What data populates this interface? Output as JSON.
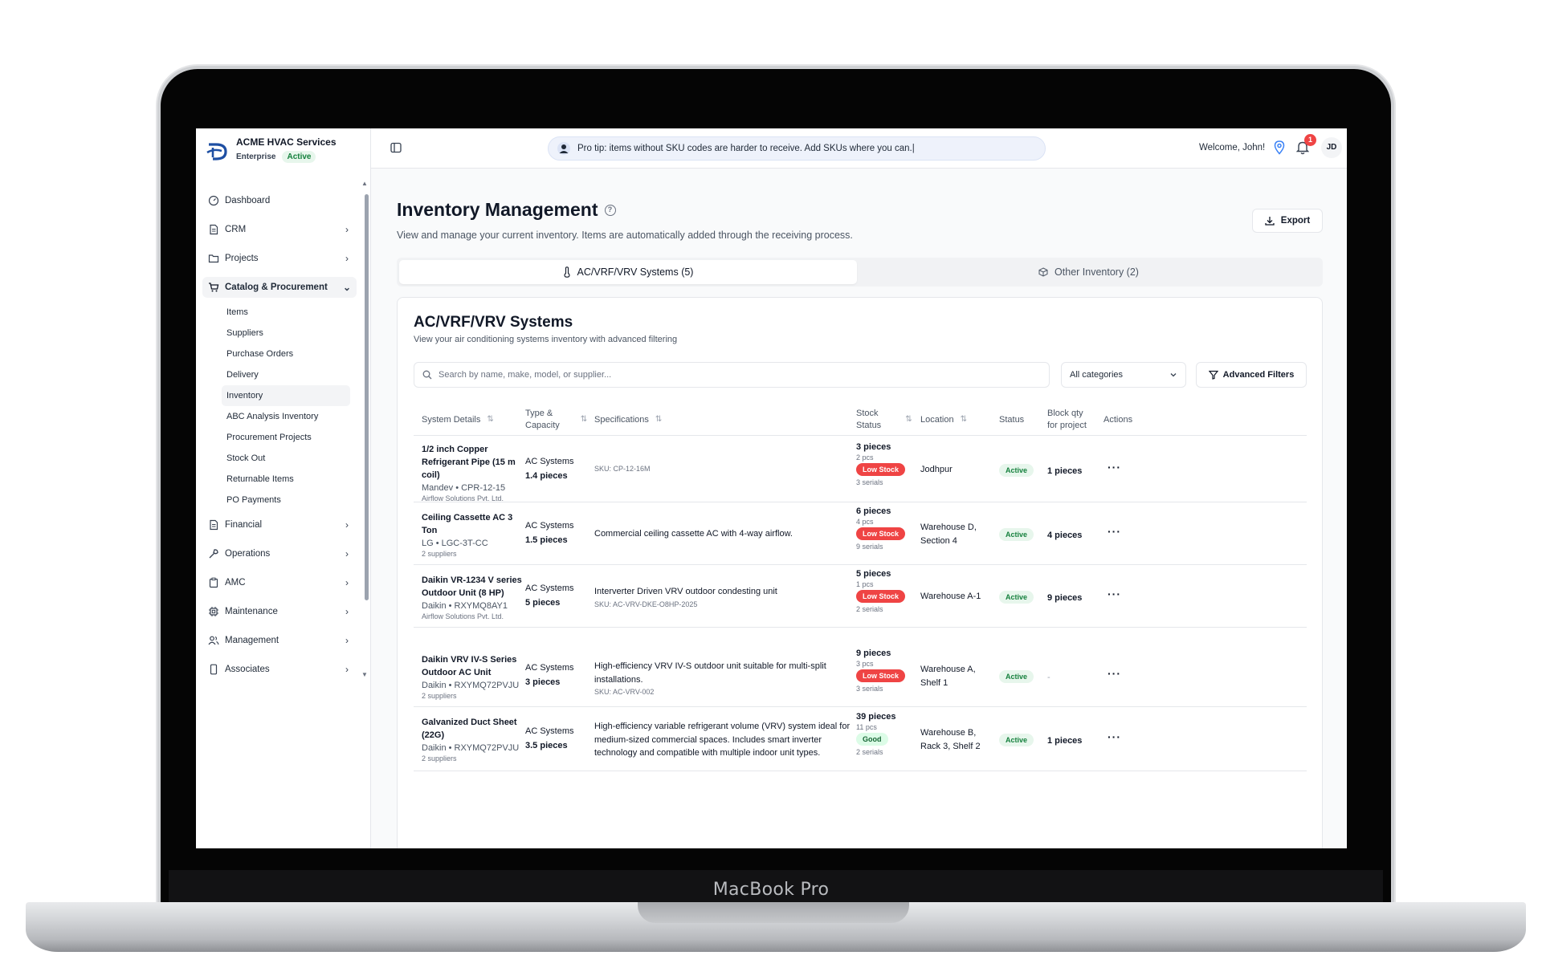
{
  "device": {
    "brand": "MacBook Pro"
  },
  "org": {
    "name": "ACME HVAC Services",
    "plan": "Enterprise",
    "status": "Active"
  },
  "header": {
    "tip": "Pro tip: items without SKU codes are harder to receive. Add SKUs where you can.|",
    "welcome": "Welcome, John!",
    "notification_count": "1",
    "avatar_initials": "JD"
  },
  "sidebar": {
    "items": [
      {
        "label": "Dashboard",
        "icon": "dashboard-icon",
        "chevron": ""
      },
      {
        "label": "CRM",
        "icon": "document-icon",
        "chevron": "›"
      },
      {
        "label": "Projects",
        "icon": "folder-icon",
        "chevron": "›"
      },
      {
        "label": "Catalog & Procurement",
        "icon": "cart-icon",
        "chevron": "⌄"
      },
      {
        "label": "Financial",
        "icon": "document-icon",
        "chevron": "›"
      },
      {
        "label": "Operations",
        "icon": "wrench-icon",
        "chevron": "›"
      },
      {
        "label": "AMC",
        "icon": "clipboard-icon",
        "chevron": "›"
      },
      {
        "label": "Maintenance",
        "icon": "chip-icon",
        "chevron": "›"
      },
      {
        "label": "Management",
        "icon": "users-icon",
        "chevron": "›"
      },
      {
        "label": "Associates",
        "icon": "phone-icon",
        "chevron": "›"
      }
    ],
    "sub_items": [
      "Items",
      "Suppliers",
      "Purchase Orders",
      "Delivery",
      "Inventory",
      "ABC Analysis Inventory",
      "Procurement Projects",
      "Stock Out",
      "Returnable Items",
      "PO Payments"
    ],
    "active_sub": "Inventory"
  },
  "page": {
    "title": "Inventory Management",
    "subtitle": "View and manage your current inventory. Items are automatically added through the receiving process.",
    "export_label": "Export"
  },
  "tabs": [
    {
      "label": "AC/VRF/VRV Systems (5)",
      "icon": "thermometer-icon"
    },
    {
      "label": "Other Inventory (2)",
      "icon": "box-icon"
    }
  ],
  "card": {
    "title": "AC/VRF/VRV Systems",
    "subtitle": "View your air conditioning systems inventory with advanced filtering",
    "search_placeholder": "Search by name, make, model, or supplier...",
    "category_select": "All categories",
    "advanced_filters": "Advanced Filters"
  },
  "table": {
    "columns": {
      "system": "System Details",
      "type_1": "Type &",
      "type_2": "Capacity",
      "spec": "Specifications",
      "stock_1": "Stock",
      "stock_2": "Status",
      "location": "Location",
      "status": "Status",
      "block_1": "Block qty",
      "block_2": "for project",
      "actions": "Actions"
    },
    "rows": [
      {
        "name": "1/2 inch Copper Refrigerant Pipe (15 m coil)",
        "make": "Mandev • CPR-12-15",
        "suppliers": "Airflow Solutions Pvt. Ltd.",
        "type": "AC Systems",
        "capacity": "1.4 pieces",
        "spec": "",
        "sku": "SKU: CP-12-16M",
        "stock_qty": "3 pieces",
        "stock_pcs": "2 pcs",
        "stock_badge": "Low Stock",
        "serials": "3 serials",
        "location": "Jodhpur",
        "status": "Active",
        "block": "1 pieces",
        "actions": "···"
      },
      {
        "name": "Ceiling Cassette AC 3 Ton",
        "make": "LG • LGC-3T-CC",
        "suppliers": "2 suppliers",
        "type": "AC Systems",
        "capacity": "1.5 pieces",
        "spec": "Commercial ceiling cassette AC with 4-way airflow.",
        "sku": "",
        "stock_qty": "6 pieces",
        "stock_pcs": "4 pcs",
        "stock_badge": "Low Stock",
        "serials": "9 serials",
        "location": "Warehouse D, Section 4",
        "status": "Active",
        "block": "4 pieces",
        "actions": "···"
      },
      {
        "name": "Daikin VR-1234 V series Outdoor Unit (8 HP)",
        "make": "Daikin • RXYMQ8AY1",
        "suppliers": "Airflow Solutions Pvt. Ltd.",
        "type": "AC Systems",
        "capacity": "5 pieces",
        "spec": "Interverter Driven VRV outdoor condesting unit",
        "sku": "SKU: AC-VRV-DKE-O8HP-2025",
        "stock_qty": "5 pieces",
        "stock_pcs": "1 pcs",
        "stock_badge": "Low Stock",
        "serials": "2 serials",
        "location": "Warehouse A-1",
        "status": "Active",
        "block": "9 pieces",
        "actions": "···"
      },
      {
        "name": "Daikin VRV IV-S Series Outdoor AC Unit",
        "make": "Daikin • RXYMQ72PVJU",
        "suppliers": "2 suppliers",
        "type": "AC Systems",
        "capacity": "3 pieces",
        "spec": "High-efficiency VRV IV-S outdoor unit suitable for multi-split installations.",
        "sku": "SKU: AC-VRV-002",
        "stock_qty": "9 pieces",
        "stock_pcs": "3 pcs",
        "stock_badge": "Low Stock",
        "serials": "3 serials",
        "location": "Warehouse A, Shelf 1",
        "status": "Active",
        "block": "-",
        "actions": "···"
      },
      {
        "name": "Galvanized Duct Sheet (22G)",
        "make": "Daikin • RXYMQ72PVJU",
        "suppliers": "2 suppliers",
        "type": "AC Systems",
        "capacity": "3.5 pieces",
        "spec": "High-efficiency variable refrigerant volume (VRV) system ideal for medium-sized commercial spaces. Includes smart inverter technology and compatible with multiple indoor unit types.",
        "sku": "",
        "stock_qty": "39 pieces",
        "stock_pcs": "11 pcs",
        "stock_badge": "Good",
        "serials": "2 serials",
        "location": "Warehouse B, Rack 3, Shelf 2",
        "status": "Active",
        "block": "1 pieces",
        "actions": "···"
      }
    ]
  }
}
